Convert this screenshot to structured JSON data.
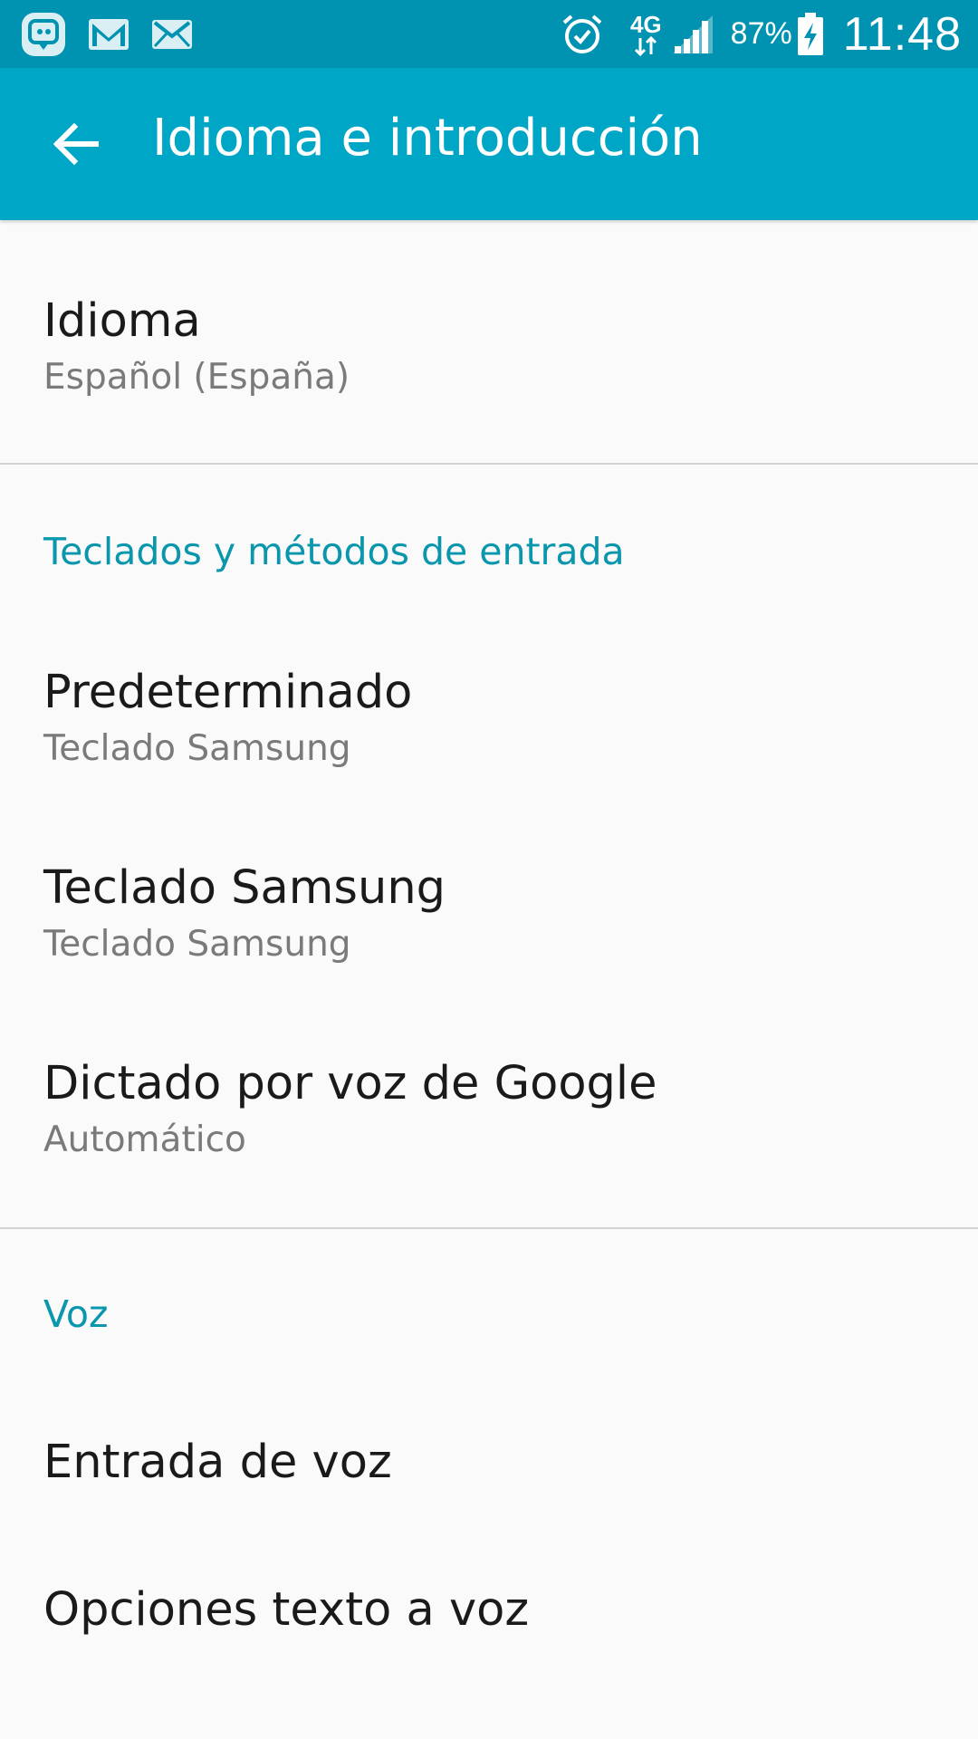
{
  "status_bar": {
    "notifications": [
      "chat-app-icon",
      "gmail-icon",
      "mail-icon"
    ],
    "status_icons": [
      "alarm-icon",
      "network-4g-icon",
      "signal-icon",
      "battery-charging-icon"
    ],
    "network": "4G",
    "battery_percent": "87%",
    "time": "11:48"
  },
  "app_bar": {
    "title": "Idioma e introducción",
    "back_icon": "arrow-back-icon"
  },
  "colors": {
    "status_bar": "#0092b1",
    "app_bar": "#00a6c5",
    "accent": "#0a96ac",
    "background": "#fafafa"
  },
  "language": {
    "title": "Idioma",
    "value": "Español (España)"
  },
  "keyboards": {
    "header": "Teclados y métodos de entrada",
    "items": [
      {
        "title": "Predeterminado",
        "subtitle": "Teclado Samsung"
      },
      {
        "title": "Teclado Samsung",
        "subtitle": "Teclado Samsung"
      },
      {
        "title": "Dictado por voz de Google",
        "subtitle": "Automático"
      }
    ]
  },
  "voice": {
    "header": "Voz",
    "items": [
      {
        "title": "Entrada de voz"
      },
      {
        "title": "Opciones texto a voz"
      }
    ]
  }
}
